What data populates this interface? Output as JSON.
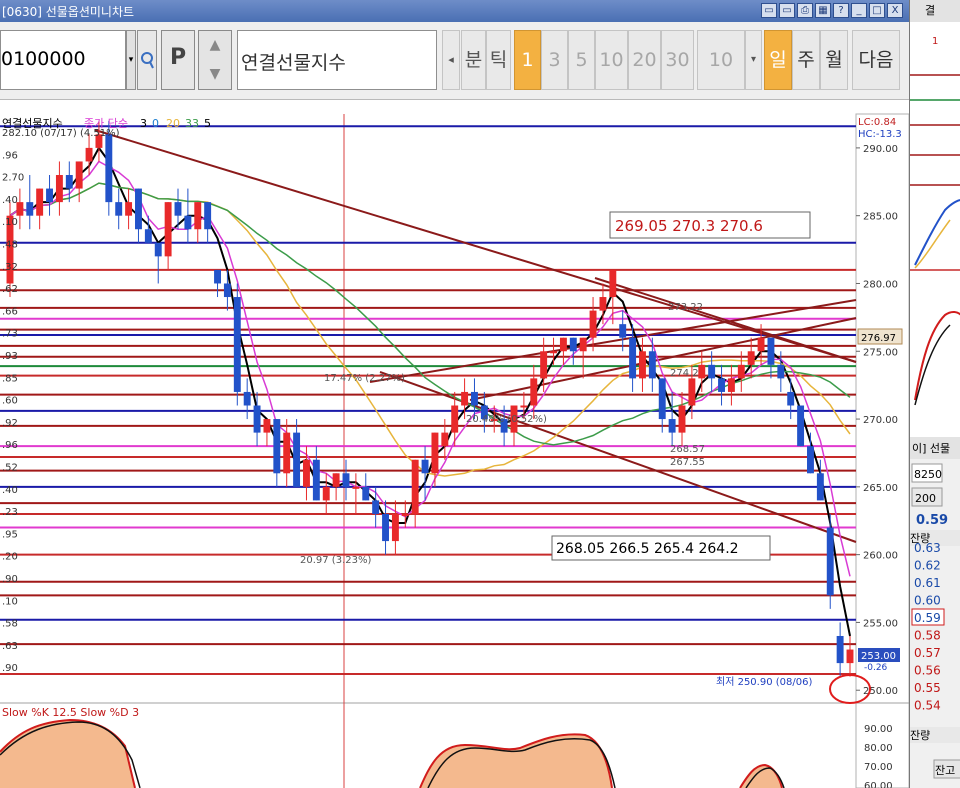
{
  "window": {
    "title": "[0630] 선물옵션미니차트",
    "buttons": [
      "▭",
      "▭",
      "⎙",
      "▦",
      "?",
      "_",
      "□",
      "X"
    ]
  },
  "toolbar": {
    "code": "0100000",
    "p_label": "P",
    "name": "연결선물지수",
    "unit_buttons": [
      "분",
      "틱"
    ],
    "period_buttons": [
      "1",
      "3",
      "5",
      "10",
      "20",
      "30"
    ],
    "active_period": "1",
    "count_value": "10",
    "view_buttons": [
      "일",
      "주",
      "월"
    ],
    "active_view": "일",
    "next_label": "다음"
  },
  "chart_header": {
    "title": "연결선물지수",
    "ma_label": "종가 단순",
    "ma_periods": [
      "3",
      "0",
      "20",
      "33",
      "5"
    ],
    "lc": "LC:0.84",
    "hc": "HC:-13.3",
    "price_tag": "253.00",
    "change_tag": "-0.26"
  },
  "left_labels": [
    "282.10 (07/17) (4.51%)",
    ".96",
    "2.70",
    ".40",
    ".10",
    ".48",
    ".32",
    ".62",
    ".66",
    ".73",
    ".93",
    ".85",
    ".60",
    ".92",
    ".96",
    ".52",
    ".40",
    ".23",
    ".95",
    ".20",
    ".90",
    ".10",
    ".58",
    ".63",
    ".90"
  ],
  "annotations": {
    "box_top": "269.05 270.3 270.6",
    "box_mid": "268.05 266.5 265.4 264.2",
    "ann_27322": "273.22",
    "ann_1747": "17.47% (2.27%)",
    "ann_26857": "268.57",
    "ann_26755": "267.55",
    "ann_2097": "20.97 (3.23%)",
    "ann_low": "최저 250.90 (08/06)",
    "ann_2742": "274.2",
    "ann_mid": "20.48% (0.52%)"
  },
  "stoch": {
    "label": "Slow %K 12.5  Slow %D 3",
    "ticks": [
      "90.00",
      "80.00",
      "70.00",
      "60.00"
    ]
  },
  "colors": {
    "up": "#e8292a",
    "down": "#2252c9",
    "ma3": "#000000",
    "ma20": "#e7b53c",
    "ma33": "#3c9c4a",
    "ma5": "#d83bd4",
    "trend": "#8b1a1a"
  },
  "chart_data": {
    "type": "candlestick",
    "y_axis_ticks": [
      "290.00",
      "285.00",
      "280.00",
      "275.00",
      "270.00",
      "265.00",
      "260.00",
      "255.00",
      "250.00"
    ],
    "ylim": [
      249.5,
      292.5
    ],
    "current_price": "276.97",
    "h_lines": [
      {
        "price": 291.6,
        "color": "#1a1aa8"
      },
      {
        "price": 283.0,
        "color": "#1a1aa8"
      },
      {
        "price": 281.0,
        "color": "#c72a2a"
      },
      {
        "price": 279.5,
        "color": "#a01818"
      },
      {
        "price": 278.2,
        "color": "#a01818"
      },
      {
        "price": 277.4,
        "color": "#e13acf"
      },
      {
        "price": 276.6,
        "color": "#a01818"
      },
      {
        "price": 276.2,
        "color": "#1a1aa8"
      },
      {
        "price": 275.4,
        "color": "#a01818"
      },
      {
        "price": 274.6,
        "color": "#a01818"
      },
      {
        "price": 273.9,
        "color": "#1e8a3a"
      },
      {
        "price": 273.2,
        "color": "#c72a2a"
      },
      {
        "price": 271.8,
        "color": "#a01818"
      },
      {
        "price": 270.6,
        "color": "#1a1aa8"
      },
      {
        "price": 269.5,
        "color": "#a01818"
      },
      {
        "price": 268.0,
        "color": "#e13acf"
      },
      {
        "price": 267.2,
        "color": "#c72a2a"
      },
      {
        "price": 266.2,
        "color": "#a01818"
      },
      {
        "price": 265.0,
        "color": "#1a1aa8"
      },
      {
        "price": 263.8,
        "color": "#a01818"
      },
      {
        "price": 263.0,
        "color": "#c72a2a"
      },
      {
        "price": 262.0,
        "color": "#e13acf"
      },
      {
        "price": 260.0,
        "color": "#c72a2a"
      },
      {
        "price": 258.0,
        "color": "#a01818"
      },
      {
        "price": 257.0,
        "color": "#a01818"
      },
      {
        "price": 255.2,
        "color": "#1a1aa8"
      },
      {
        "price": 253.4,
        "color": "#a01818"
      },
      {
        "price": 251.2,
        "color": "#c72a2a"
      }
    ],
    "candles": [
      {
        "o": 280,
        "h": 286,
        "l": 279,
        "c": 285
      },
      {
        "o": 285,
        "h": 287,
        "l": 284,
        "c": 286
      },
      {
        "o": 286,
        "h": 288,
        "l": 284,
        "c": 285
      },
      {
        "o": 285,
        "h": 287,
        "l": 284,
        "c": 287
      },
      {
        "o": 287,
        "h": 288,
        "l": 285,
        "c": 286
      },
      {
        "o": 286,
        "h": 289,
        "l": 285,
        "c": 288
      },
      {
        "o": 288,
        "h": 289,
        "l": 286,
        "c": 287
      },
      {
        "o": 287,
        "h": 289,
        "l": 286,
        "c": 289
      },
      {
        "o": 289,
        "h": 291,
        "l": 288,
        "c": 290
      },
      {
        "o": 290,
        "h": 292,
        "l": 289,
        "c": 291
      },
      {
        "o": 291,
        "h": 292,
        "l": 285,
        "c": 286
      },
      {
        "o": 286,
        "h": 287,
        "l": 284,
        "c": 285
      },
      {
        "o": 285,
        "h": 287,
        "l": 284,
        "c": 286
      },
      {
        "o": 287,
        "h": 287,
        "l": 283,
        "c": 284
      },
      {
        "o": 284,
        "h": 285,
        "l": 283,
        "c": 283
      },
      {
        "o": 283,
        "h": 283,
        "l": 280,
        "c": 282
      },
      {
        "o": 282,
        "h": 286,
        "l": 281,
        "c": 286
      },
      {
        "o": 286,
        "h": 287,
        "l": 284,
        "c": 285
      },
      {
        "o": 285,
        "h": 287,
        "l": 283,
        "c": 284
      },
      {
        "o": 284,
        "h": 286,
        "l": 283,
        "c": 286
      },
      {
        "o": 286,
        "h": 286,
        "l": 283,
        "c": 284
      },
      {
        "o": 281,
        "h": 281,
        "l": 279,
        "c": 280
      },
      {
        "o": 280,
        "h": 281,
        "l": 278,
        "c": 279
      },
      {
        "o": 279,
        "h": 280,
        "l": 271,
        "c": 272
      },
      {
        "o": 272,
        "h": 273,
        "l": 270,
        "c": 271
      },
      {
        "o": 271,
        "h": 272,
        "l": 268,
        "c": 269
      },
      {
        "o": 269,
        "h": 270,
        "l": 268,
        "c": 270
      },
      {
        "o": 270,
        "h": 270,
        "l": 265,
        "c": 266
      },
      {
        "o": 266,
        "h": 270,
        "l": 265,
        "c": 269
      },
      {
        "o": 269,
        "h": 270,
        "l": 265,
        "c": 265
      },
      {
        "o": 265,
        "h": 268,
        "l": 264,
        "c": 267
      },
      {
        "o": 267,
        "h": 268,
        "l": 264,
        "c": 264
      },
      {
        "o": 264,
        "h": 266,
        "l": 263,
        "c": 265
      },
      {
        "o": 265,
        "h": 266,
        "l": 264,
        "c": 266
      },
      {
        "o": 266,
        "h": 267,
        "l": 264,
        "c": 265
      },
      {
        "o": 265,
        "h": 266,
        "l": 263,
        "c": 265
      },
      {
        "o": 265,
        "h": 266,
        "l": 264,
        "c": 264
      },
      {
        "o": 264,
        "h": 265,
        "l": 262,
        "c": 263
      },
      {
        "o": 263,
        "h": 264,
        "l": 260,
        "c": 261
      },
      {
        "o": 261,
        "h": 264,
        "l": 260,
        "c": 263
      },
      {
        "o": 263,
        "h": 264,
        "l": 262,
        "c": 263
      },
      {
        "o": 263,
        "h": 267,
        "l": 262,
        "c": 267
      },
      {
        "o": 267,
        "h": 268,
        "l": 264,
        "c": 266
      },
      {
        "o": 266,
        "h": 269,
        "l": 265,
        "c": 269
      },
      {
        "o": 268,
        "h": 270,
        "l": 267,
        "c": 269
      },
      {
        "o": 269,
        "h": 272,
        "l": 268,
        "c": 271
      },
      {
        "o": 271,
        "h": 273,
        "l": 270,
        "c": 272
      },
      {
        "o": 272,
        "h": 273,
        "l": 270,
        "c": 271
      },
      {
        "o": 271,
        "h": 272,
        "l": 269,
        "c": 270
      },
      {
        "o": 270,
        "h": 271,
        "l": 269,
        "c": 270
      },
      {
        "o": 270,
        "h": 271,
        "l": 268,
        "c": 269
      },
      {
        "o": 269,
        "h": 271,
        "l": 268,
        "c": 271
      },
      {
        "o": 271,
        "h": 272,
        "l": 270,
        "c": 271
      },
      {
        "o": 271,
        "h": 274,
        "l": 270,
        "c": 273
      },
      {
        "o": 273,
        "h": 276,
        "l": 272,
        "c": 275
      },
      {
        "o": 275,
        "h": 276,
        "l": 274,
        "c": 275
      },
      {
        "o": 275,
        "h": 276,
        "l": 274,
        "c": 276
      },
      {
        "o": 276,
        "h": 276,
        "l": 274,
        "c": 275
      },
      {
        "o": 275,
        "h": 276,
        "l": 273,
        "c": 276
      },
      {
        "o": 276,
        "h": 279,
        "l": 275,
        "c": 278
      },
      {
        "o": 278,
        "h": 280,
        "l": 277,
        "c": 279
      },
      {
        "o": 279,
        "h": 281,
        "l": 277,
        "c": 281
      },
      {
        "o": 277,
        "h": 278,
        "l": 275,
        "c": 276
      },
      {
        "o": 276,
        "h": 277,
        "l": 272,
        "c": 273
      },
      {
        "o": 273,
        "h": 276,
        "l": 272,
        "c": 275
      },
      {
        "o": 275,
        "h": 276,
        "l": 272,
        "c": 273
      },
      {
        "o": 273,
        "h": 273,
        "l": 269,
        "c": 270
      },
      {
        "o": 270,
        "h": 272,
        "l": 268,
        "c": 269
      },
      {
        "o": 269,
        "h": 272,
        "l": 268,
        "c": 271
      },
      {
        "o": 271,
        "h": 274,
        "l": 270,
        "c": 273
      },
      {
        "o": 273,
        "h": 275,
        "l": 272,
        "c": 274
      },
      {
        "o": 274,
        "h": 275,
        "l": 272,
        "c": 273
      },
      {
        "o": 273,
        "h": 274,
        "l": 271,
        "c": 272
      },
      {
        "o": 272,
        "h": 274,
        "l": 271,
        "c": 273
      },
      {
        "o": 273,
        "h": 275,
        "l": 272,
        "c": 274
      },
      {
        "o": 274,
        "h": 276,
        "l": 273,
        "c": 275
      },
      {
        "o": 275,
        "h": 277,
        "l": 274,
        "c": 276
      },
      {
        "o": 276,
        "h": 276,
        "l": 273,
        "c": 274
      },
      {
        "o": 274,
        "h": 275,
        "l": 272,
        "c": 273
      },
      {
        "o": 272,
        "h": 273,
        "l": 270,
        "c": 271
      },
      {
        "o": 271,
        "h": 271,
        "l": 268,
        "c": 268
      },
      {
        "o": 268,
        "h": 269,
        "l": 266,
        "c": 266
      },
      {
        "o": 266,
        "h": 267,
        "l": 264,
        "c": 264
      },
      {
        "o": 262,
        "h": 263,
        "l": 256,
        "c": 257
      },
      {
        "o": 254,
        "h": 255,
        "l": 251,
        "c": 252
      },
      {
        "o": 252,
        "h": 254,
        "l": 251,
        "c": 253
      }
    ]
  },
  "side_panel": {
    "labels": [
      "결",
      "1",
      "이] 선물",
      "8250",
      "200",
      "0.59",
      "잔량",
      "0.63",
      "0.62",
      "0.61",
      "0.60",
      "0.59",
      "0.58",
      "0.57",
      "0.56",
      "0.55",
      "0.54",
      "잔량",
      "잔고"
    ]
  }
}
